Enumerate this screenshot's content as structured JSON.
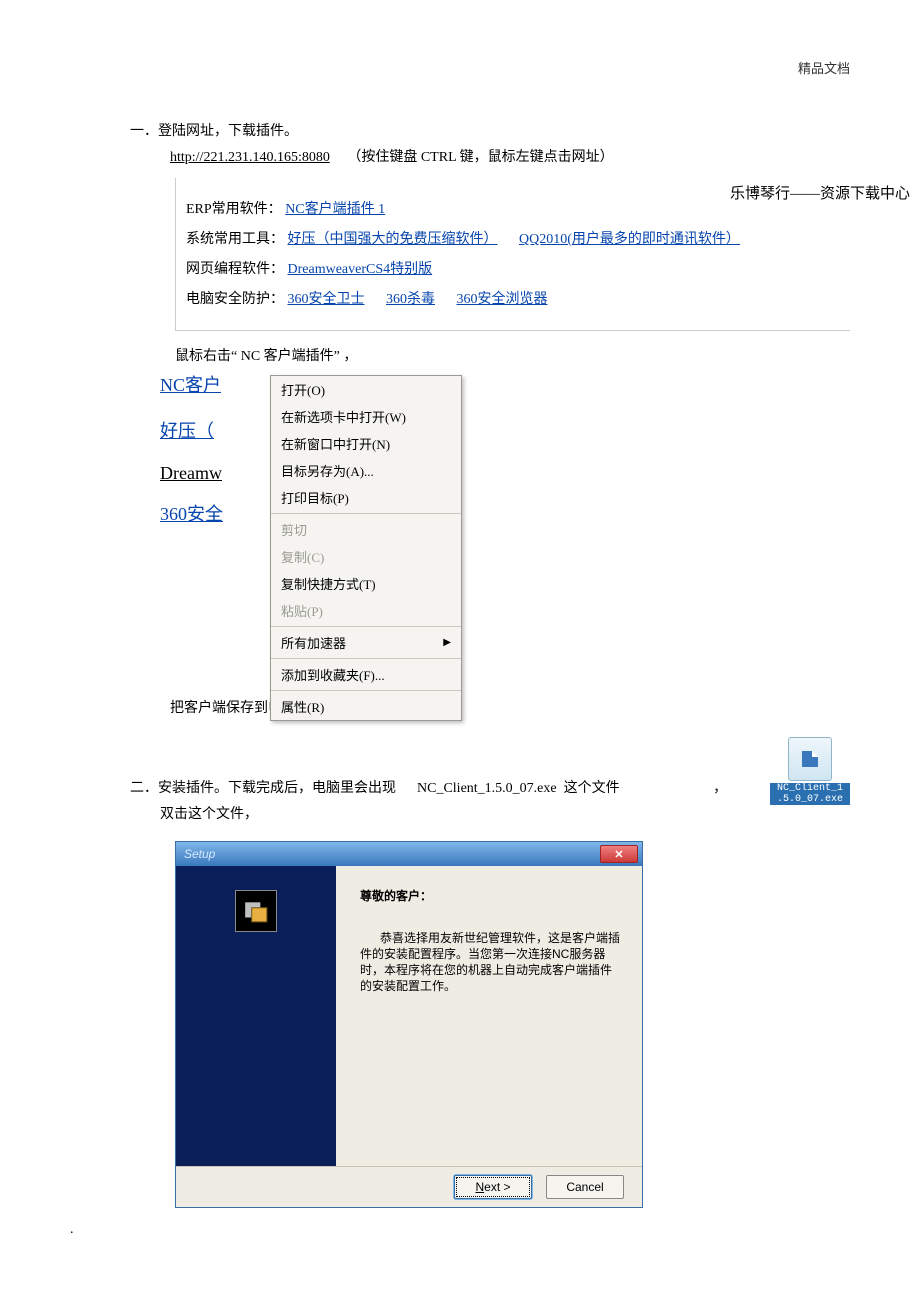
{
  "header": {
    "right": "精品文档"
  },
  "sec1": {
    "title": "一．登陆网址，下载插件。",
    "url": "http://221.231.140.165:8080",
    "url_hint": "（按住键盘   CTRL 键，鼠标左键点击网址）",
    "banner": "乐博琴行——资源下载中心",
    "rows": [
      {
        "label": "ERP常用软件：",
        "links": [
          {
            "text": "NC客户端插件 1"
          }
        ]
      },
      {
        "label": "系统常用工具：",
        "links": [
          {
            "text": "好压（中国强大的免费压缩软件）"
          },
          {
            "text": "QQ2010(用户最多的即时通讯软件）"
          }
        ]
      },
      {
        "label": "网页编程软件：",
        "links": [
          {
            "text": "DreamweaverCS4特别版"
          }
        ]
      },
      {
        "label": "电脑安全防护：",
        "links": [
          {
            "text": "360安全卫士"
          },
          {
            "text": "360杀毒"
          },
          {
            "text": "360安全浏览器"
          }
        ]
      }
    ],
    "note": "鼠标右击“ NC 客户端插件” ，",
    "frag_links": [
      "NC客户",
      "好压（",
      "Dreamw",
      "360安全"
    ],
    "context_menu": [
      {
        "text": "打开(O)",
        "type": "item"
      },
      {
        "text": "在新选项卡中打开(W)",
        "type": "item"
      },
      {
        "text": "在新窗口中打开(N)",
        "type": "item"
      },
      {
        "text": "目标另存为(A)...",
        "type": "item"
      },
      {
        "text": "打印目标(P)",
        "type": "item"
      },
      {
        "type": "sep"
      },
      {
        "text": "剪切",
        "type": "disabled"
      },
      {
        "text": "复制(C)",
        "type": "disabled"
      },
      {
        "text": "复制快捷方式(T)",
        "type": "item"
      },
      {
        "text": "粘贴(P)",
        "type": "disabled"
      },
      {
        "type": "sep"
      },
      {
        "text": "所有加速器",
        "type": "submenu"
      },
      {
        "type": "sep"
      },
      {
        "text": "添加到收藏夹(F)...",
        "type": "item"
      },
      {
        "type": "sep"
      },
      {
        "text": "属性(R)",
        "type": "item"
      }
    ],
    "save_note": "把客户端保存到电脑里。"
  },
  "sec2": {
    "line_a_pre": "二．安装插件。下载完成后，电脑里会出现",
    "line_a_file": "NC_Client_1.5.0_07.exe",
    "line_a_post": "这个文件",
    "comma": "，",
    "line_b": "双击这个文件，",
    "icon_label_1": "NC_Client_1",
    "icon_label_2": ".5.0_07.exe"
  },
  "setup": {
    "title": "Setup",
    "close": "✕",
    "greeting": "尊敬的客户：",
    "message": "恭喜选择用友新世纪管理软件，这是客户端插件的安装配置程序。当您第一次连接NC服务器时，本程序将在您的机器上自动完成客户端插件的安装配置工作。",
    "btn_next_u": "N",
    "btn_next_rest": "ext >",
    "btn_cancel": "Cancel"
  },
  "footer_dot": "."
}
